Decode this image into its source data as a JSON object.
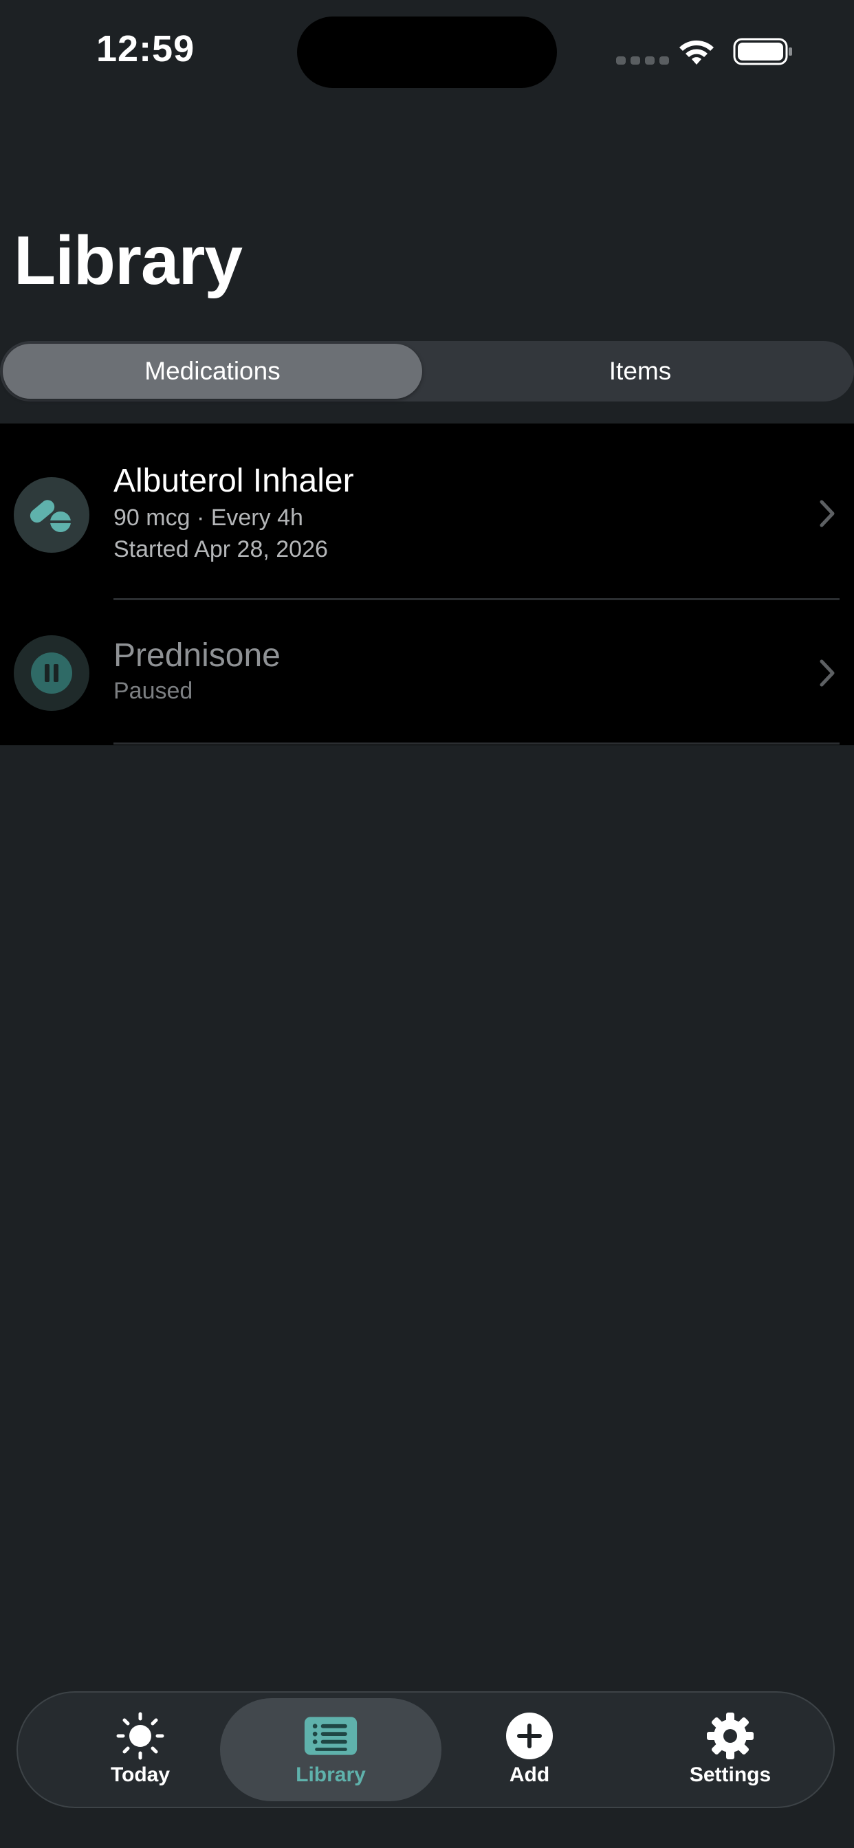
{
  "status_bar": {
    "time": "12:59"
  },
  "page": {
    "title": "Library"
  },
  "segmented_control": {
    "options": [
      "Medications",
      "Items"
    ],
    "selected": "Medications"
  },
  "medications": [
    {
      "name": "Albuterol Inhaler",
      "dose_line": "90 mcg · Every 4h",
      "started_line": "Started Apr 28, 2026",
      "icon": "pills-icon",
      "status": "active"
    },
    {
      "name": "Prednisone",
      "status_line": "Paused",
      "icon": "pause-icon",
      "status": "paused"
    }
  ],
  "tab_bar": {
    "items": [
      {
        "label": "Today",
        "icon": "sun-icon"
      },
      {
        "label": "Library",
        "icon": "list-icon",
        "selected": true
      },
      {
        "label": "Add",
        "icon": "plus-circle-icon"
      },
      {
        "label": "Settings",
        "icon": "gear-icon"
      }
    ]
  },
  "colors": {
    "background": "#1d2124",
    "accent": "#5fb2ac",
    "list_background": "#000000"
  }
}
